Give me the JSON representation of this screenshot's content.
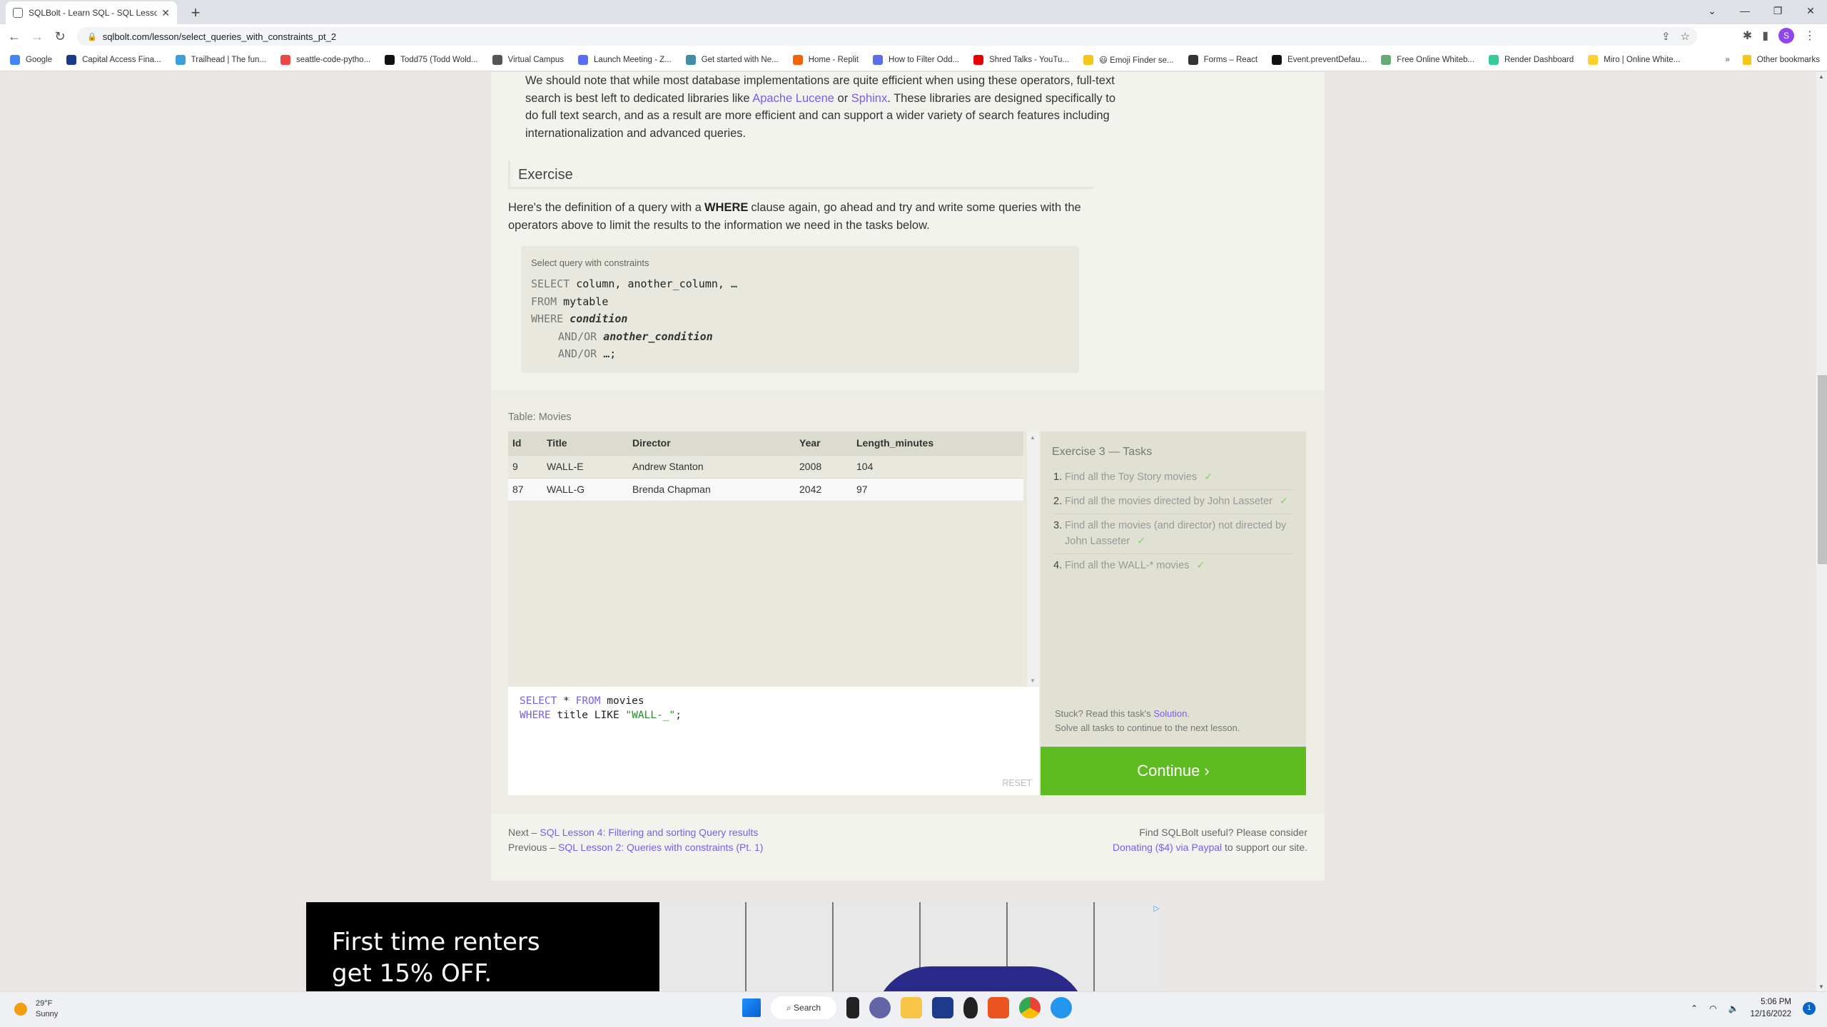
{
  "browser": {
    "tab_title": "SQLBolt - Learn SQL - SQL Lesson",
    "tab_close": "✕",
    "new_tab": "+",
    "url": "sqlbolt.com/lesson/select_queries_with_constraints_pt_2",
    "nav": {
      "back": "←",
      "forward": "→",
      "reload": "↻"
    },
    "profile_initial": "S",
    "window_controls": {
      "dropdown": "⌄",
      "minimize": "—",
      "restore": "❐",
      "close": "✕"
    },
    "bookmarks": [
      {
        "label": "Google",
        "color": "#4285f4"
      },
      {
        "label": "Capital Access Fina...",
        "color": "#1a3a8a"
      },
      {
        "label": "Trailhead | The fun...",
        "color": "#3ea0d8"
      },
      {
        "label": "seattle-code-pytho...",
        "color": "#e44"
      },
      {
        "label": "Todd75 (Todd Wold...",
        "color": "#111"
      },
      {
        "label": "Virtual Campus",
        "color": "#555"
      },
      {
        "label": "Launch Meeting - Z...",
        "color": "#5b6cf5"
      },
      {
        "label": "Get started with Ne...",
        "color": "#3c8fa6"
      },
      {
        "label": "Home - Replit",
        "color": "#f26207"
      },
      {
        "label": "How to Filter Odd...",
        "color": "#5d6ce8"
      },
      {
        "label": "Shred Talks - YouTu...",
        "color": "#e00"
      },
      {
        "label": "😃 Emoji Finder se...",
        "color": "#f5c518"
      },
      {
        "label": "Forms – React",
        "color": "#333"
      },
      {
        "label": "Event.preventDefau...",
        "color": "#111"
      },
      {
        "label": "Free Online Whiteb...",
        "color": "#6a7"
      },
      {
        "label": "Render Dashboard",
        "color": "#3c9"
      },
      {
        "label": "Miro | Online White...",
        "color": "#ffd02f"
      }
    ],
    "bookmarks_more": "»",
    "other_bookmarks": "Other bookmarks"
  },
  "lesson": {
    "para1_a": "We should note that while most database implementations are quite efficient when using these operators, full-text search is best left to dedicated libraries like ",
    "link_lucene": "Apache Lucene",
    "para1_b": " or ",
    "link_sphinx": "Sphinx",
    "para1_c": ". These libraries are designed specifically to do full text search, and as a result are more efficient and can support a wider variety of search features including internationalization and advanced queries.",
    "exercise_heading": "Exercise",
    "para2_a": "Here's the definition of a query with a",
    "para2_kw": "WHERE",
    "para2_b": "clause again, go ahead and try and write some queries with the operators above to limit the results to the information we need in the tasks below.",
    "syntax_label": "Select query with constraints",
    "syntax_lines": [
      {
        "kw": "SELECT",
        "rest": " column, another_column, …",
        "italic": false,
        "indent": false
      },
      {
        "kw": "FROM",
        "rest": " mytable",
        "italic": false,
        "indent": false
      },
      {
        "kw": "WHERE",
        "rest": " condition",
        "italic": true,
        "indent": false
      },
      {
        "kw": "AND/OR",
        "rest": " another_condition",
        "italic": true,
        "indent": true
      },
      {
        "kw": "AND/OR",
        "rest": " …;",
        "italic": false,
        "indent": true
      }
    ]
  },
  "exercise": {
    "table_label": "Table: Movies",
    "columns": [
      "Id",
      "Title",
      "Director",
      "Year",
      "Length_minutes"
    ],
    "rows": [
      [
        "9",
        "WALL-E",
        "Andrew Stanton",
        "2008",
        "104"
      ],
      [
        "87",
        "WALL-G",
        "Brenda Chapman",
        "2042",
        "97"
      ]
    ],
    "query_line1": {
      "kw1": "SELECT",
      "mid": " * ",
      "kw2": "FROM",
      "rest": " movies"
    },
    "query_line2": {
      "kw": "WHERE",
      "mid": " title LIKE ",
      "str": "\"WALL-_\"",
      "end": ";"
    },
    "reset_label": "RESET",
    "tasks_title": "Exercise 3 — Tasks",
    "tasks": [
      {
        "num": "1.",
        "text": "Find all the Toy Story movies",
        "done": "✓"
      },
      {
        "num": "2.",
        "text": "Find all the movies directed by John Lasseter",
        "done": "✓"
      },
      {
        "num": "3.",
        "text": "Find all the movies (and director) not directed by John Lasseter",
        "done": "✓"
      },
      {
        "num": "4.",
        "text": "Find all the WALL-* movies",
        "done": "✓"
      }
    ],
    "stuck_text": "Stuck? Read this task's ",
    "solution_link": "Solution",
    "stuck_end": ".",
    "solve_all": "Solve all tasks to continue to the next lesson.",
    "continue_label": "Continue ›",
    "accent_color": "#5ebc21"
  },
  "footer": {
    "next_prefix": "Next – ",
    "next_link": "SQL Lesson 4: Filtering and sorting Query results",
    "prev_prefix": "Previous – ",
    "prev_link": "SQL Lesson 2: Queries with constraints (Pt. 1)",
    "donate_line1": "Find SQLBolt useful? Please consider",
    "donate_link": "Donating ($4) via Paypal",
    "donate_end": " to support our site."
  },
  "ad": {
    "line1": "First time renters",
    "line2": "get 15% OFF.",
    "adchoices": "▷"
  },
  "taskbar": {
    "temp": "29°F",
    "condition": "Sunny",
    "search_label": "Search",
    "time": "5:06 PM",
    "date": "12/16/2022",
    "notification_count": "1"
  }
}
